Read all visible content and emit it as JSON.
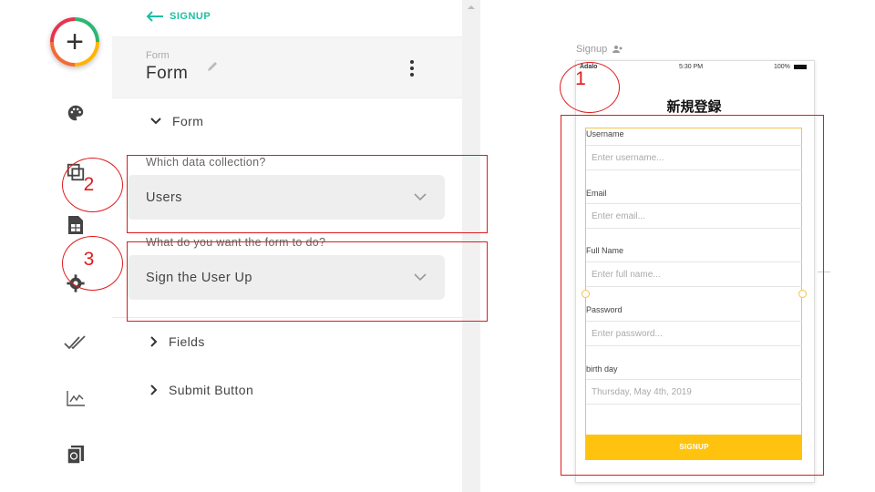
{
  "back": {
    "label": "SIGNUP"
  },
  "form_header": {
    "small": "Form",
    "title": "Form"
  },
  "form_section": {
    "label": "Form"
  },
  "data_collection": {
    "question": "Which data collection?",
    "value": "Users"
  },
  "form_action": {
    "question": "What do you want the form to do?",
    "value": "Sign the User Up"
  },
  "sections": [
    {
      "label": "Fields"
    },
    {
      "label": "Submit Button"
    }
  ],
  "canvas": {
    "screen_name": "Signup",
    "status": {
      "carrier": "Adalo",
      "time": "5:30 PM",
      "battery": "100%"
    },
    "screen_title": "新規登録",
    "fields": [
      {
        "label": "Username",
        "placeholder": "Enter username..."
      },
      {
        "label": "Email",
        "placeholder": "Enter email..."
      },
      {
        "label": "Full Name",
        "placeholder": "Enter full name..."
      },
      {
        "label": "Password",
        "placeholder": "Enter password..."
      },
      {
        "label": "birth day",
        "placeholder": "Thursday, May 4th, 2019"
      }
    ],
    "submit_label": "SIGNUP"
  },
  "annotations": {
    "one": "1",
    "two": "2",
    "three": "3"
  },
  "colors": {
    "accent": "#1bbfa3",
    "button": "#ffc20e",
    "annotation": "#e01b1b",
    "selection": "#f4c24a"
  }
}
